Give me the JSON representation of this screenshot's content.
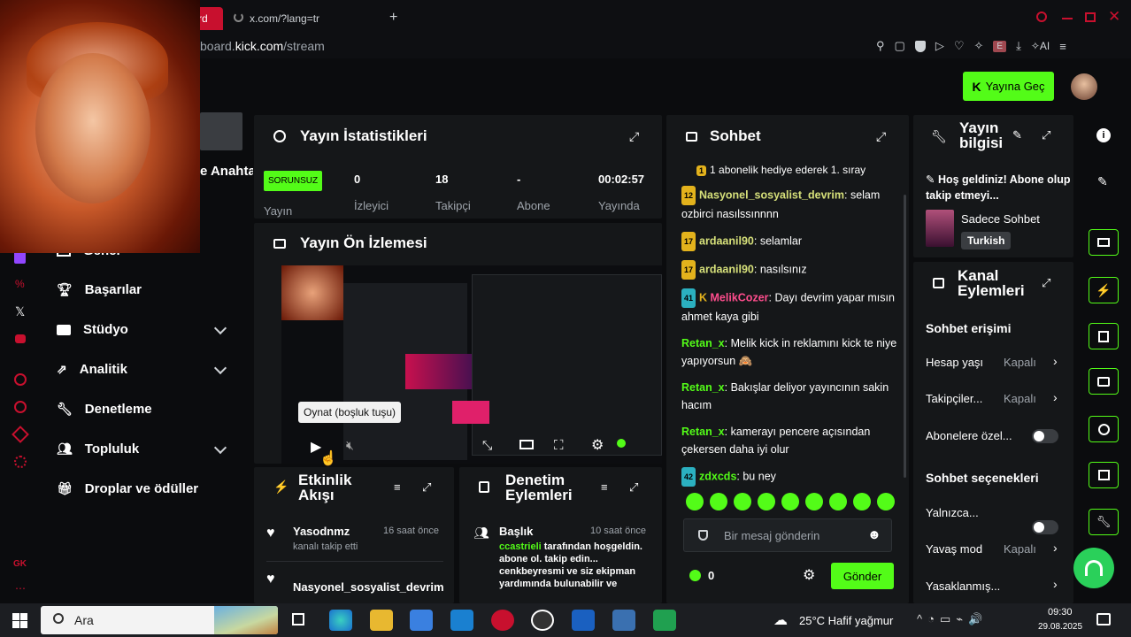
{
  "browser": {
    "tab_active_label": "rd",
    "tab_second_label": "x.com/?lang=tr",
    "url_prefix": "board.",
    "url_domain": "kick.com",
    "url_path": "/stream",
    "ext_badge": "E",
    "ai_label": "AI"
  },
  "header": {
    "go_live_label": "Yayına Geç"
  },
  "sidebar": {
    "keys_label": "e Anahtar",
    "items": [
      {
        "label": "Genel"
      },
      {
        "label": "Başarılar"
      },
      {
        "label": "Stüdyo"
      },
      {
        "label": "Analitik"
      },
      {
        "label": "Denetleme"
      },
      {
        "label": "Topluluk"
      },
      {
        "label": "Droplar ve ödüller"
      }
    ],
    "bottom_label": "GK"
  },
  "stats": {
    "title": "Yayın İstatistikleri",
    "status_badge": "SORUNSUZ",
    "status_label": "Yayın",
    "items": [
      {
        "value": "0",
        "label": "İzleyici"
      },
      {
        "value": "18",
        "label": "Takipçi"
      },
      {
        "value": "-",
        "label": "Abone"
      },
      {
        "value": "00:02:57",
        "label": "Yayında"
      }
    ]
  },
  "preview": {
    "title": "Yayın Ön İzlemesi",
    "tooltip": "Oynat (boşluk tuşu)"
  },
  "activity": {
    "title": "Etkinlik Akışı",
    "items": [
      {
        "user": "Yasodnmz",
        "time": "16 saat önce",
        "desc": "kanalı takip etti"
      },
      {
        "user": "Nasyonel_sosyalist_devrim",
        "time": "",
        "desc": ""
      }
    ]
  },
  "moderation": {
    "title": "Denetim Eylemleri",
    "item": {
      "label": "Başlık",
      "time": "10 saat önce",
      "user": "ccastrieli",
      "text1": " tarafından hoşgeldin.",
      "text2": "abone ol. takip edin...",
      "text3": "cenkbeyresmi ve siz ekipman",
      "text4": "yardımında bulunabilir ve"
    }
  },
  "chat": {
    "title": "Sohbet",
    "pinned": "1 abonelik hediye ederek 1. sıray",
    "messages": [
      {
        "badge": "12",
        "user": "Nasyonel_sosyalist_devrim",
        "text": "selam ozbirci nasılssınnnn"
      },
      {
        "badge": "17",
        "user": "ardaanil90",
        "text": "selamlar"
      },
      {
        "badge": "17",
        "user": "ardaanil90",
        "text": "nasılsınız"
      },
      {
        "badge": "41",
        "user": "MelikCozer",
        "text": "Dayı devrim yapar mısın ahmet kaya gibi"
      },
      {
        "badge": "",
        "user": "Retan_x",
        "text": "Melik kick in reklamını kick te niye yapıyorsun"
      },
      {
        "badge": "",
        "user": "Retan_x",
        "text": "Bakışlar deliyor yayıncının sakin hacım"
      },
      {
        "badge": "",
        "user": "Retan_x",
        "text": "kamerayı pencere açısından çekersen daha iyi olur"
      },
      {
        "badge": "42",
        "user": "zdxcds",
        "text": "bu ney"
      }
    ],
    "input_placeholder": "Bir mesaj gönderin",
    "points": "0",
    "send_label": "Gönder"
  },
  "stream_info": {
    "title": "Yayın bilgisi",
    "welcome": "Hoş geldiniz! Abone olup takip etmeyi...",
    "category": "Sadece Sohbet",
    "language": "Turkish"
  },
  "channel_actions": {
    "title": "Kanal Eylemleri",
    "chat_access": "Sohbet erişimi",
    "rows": [
      {
        "label": "Hesap yaşı",
        "value": "Kapalı"
      },
      {
        "label": "Takipçiler...",
        "value": "Kapalı"
      },
      {
        "label": "Abonelere özel...",
        "value": ""
      }
    ],
    "chat_options": "Sohbet seçenekleri",
    "rows2": [
      {
        "label": "Yalnızca...",
        "value": ""
      },
      {
        "label": "Yavaş mod",
        "value": "Kapalı"
      },
      {
        "label": "Yasaklanmış...",
        "value": ""
      }
    ]
  },
  "taskbar": {
    "search": "Ara",
    "weather": "25°C  Hafif yağmur",
    "time": "09:30",
    "date": "29.08.2025"
  }
}
